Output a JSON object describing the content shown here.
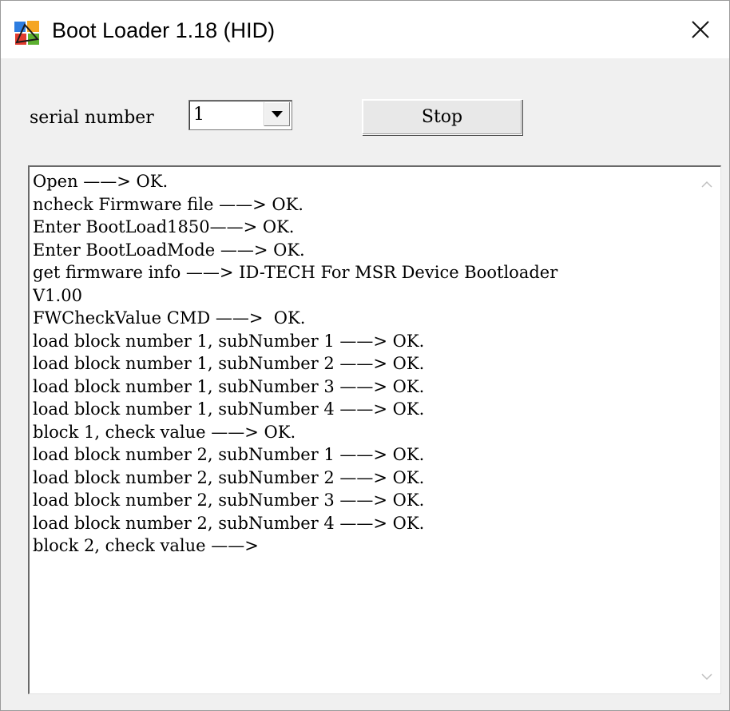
{
  "window": {
    "title": "Boot Loader 1.18 (HID)"
  },
  "controls": {
    "serial_label": "serial number",
    "serial_value": "1",
    "stop_label": "Stop"
  },
  "log": {
    "lines": [
      "Open ——> OK.",
      "ncheck Firmware file ——> OK.",
      "Enter BootLoad1850——> OK.",
      "Enter BootLoadMode ——> OK.",
      "get firmware info ——> ID-TECH For MSR Device Bootloader",
      "V1.00",
      "FWCheckValue CMD ——>  OK.",
      "load block number 1, subNumber 1 ——> OK.",
      "load block number 1, subNumber 2 ——> OK.",
      "load block number 1, subNumber 3 ——> OK.",
      "load block number 1, subNumber 4 ——> OK.",
      "block 1, check value ——> OK.",
      "load block number 2, subNumber 1 ——> OK.",
      "load block number 2, subNumber 2 ——> OK.",
      "load block number 2, subNumber 3 ——> OK.",
      "load block number 2, subNumber 4 ——> OK.",
      "block 2, check value ——>"
    ]
  },
  "icons": {
    "app": "app-icon",
    "close": "close-icon",
    "dropdown": "chevron-down-icon",
    "scroll_up": "scroll-up-icon",
    "scroll_down": "scroll-down-icon"
  }
}
